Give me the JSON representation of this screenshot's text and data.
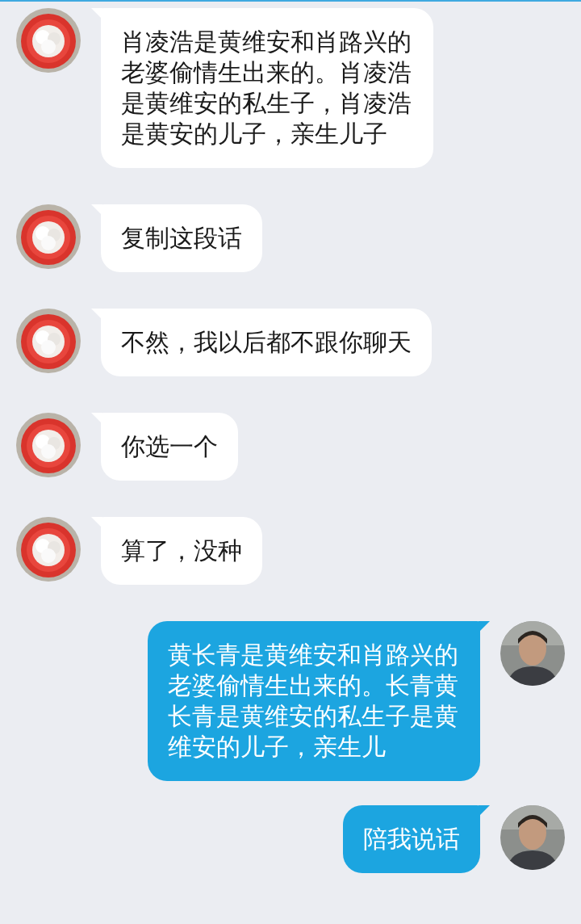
{
  "messages": [
    {
      "kind": "incoming",
      "text": "肖凌浩是黄维安和肖路兴的老婆偷情生出来的。肖凌浩是黄维安的私生子，肖凌浩是黄安的儿子，亲生儿子"
    },
    {
      "kind": "incoming",
      "text": "复制这段话"
    },
    {
      "kind": "incoming",
      "text": "不然，我以后都不跟你聊天"
    },
    {
      "kind": "incoming",
      "text": "你选一个"
    },
    {
      "kind": "incoming",
      "text": "算了，没种"
    },
    {
      "kind": "outgoing",
      "text": "黄长青是黄维安和肖路兴的老婆偷情生出来的。长青黄长青是黄维安的私生子是黄维安的儿子，亲生儿"
    },
    {
      "kind": "outgoing",
      "text": "陪我说话"
    }
  ]
}
